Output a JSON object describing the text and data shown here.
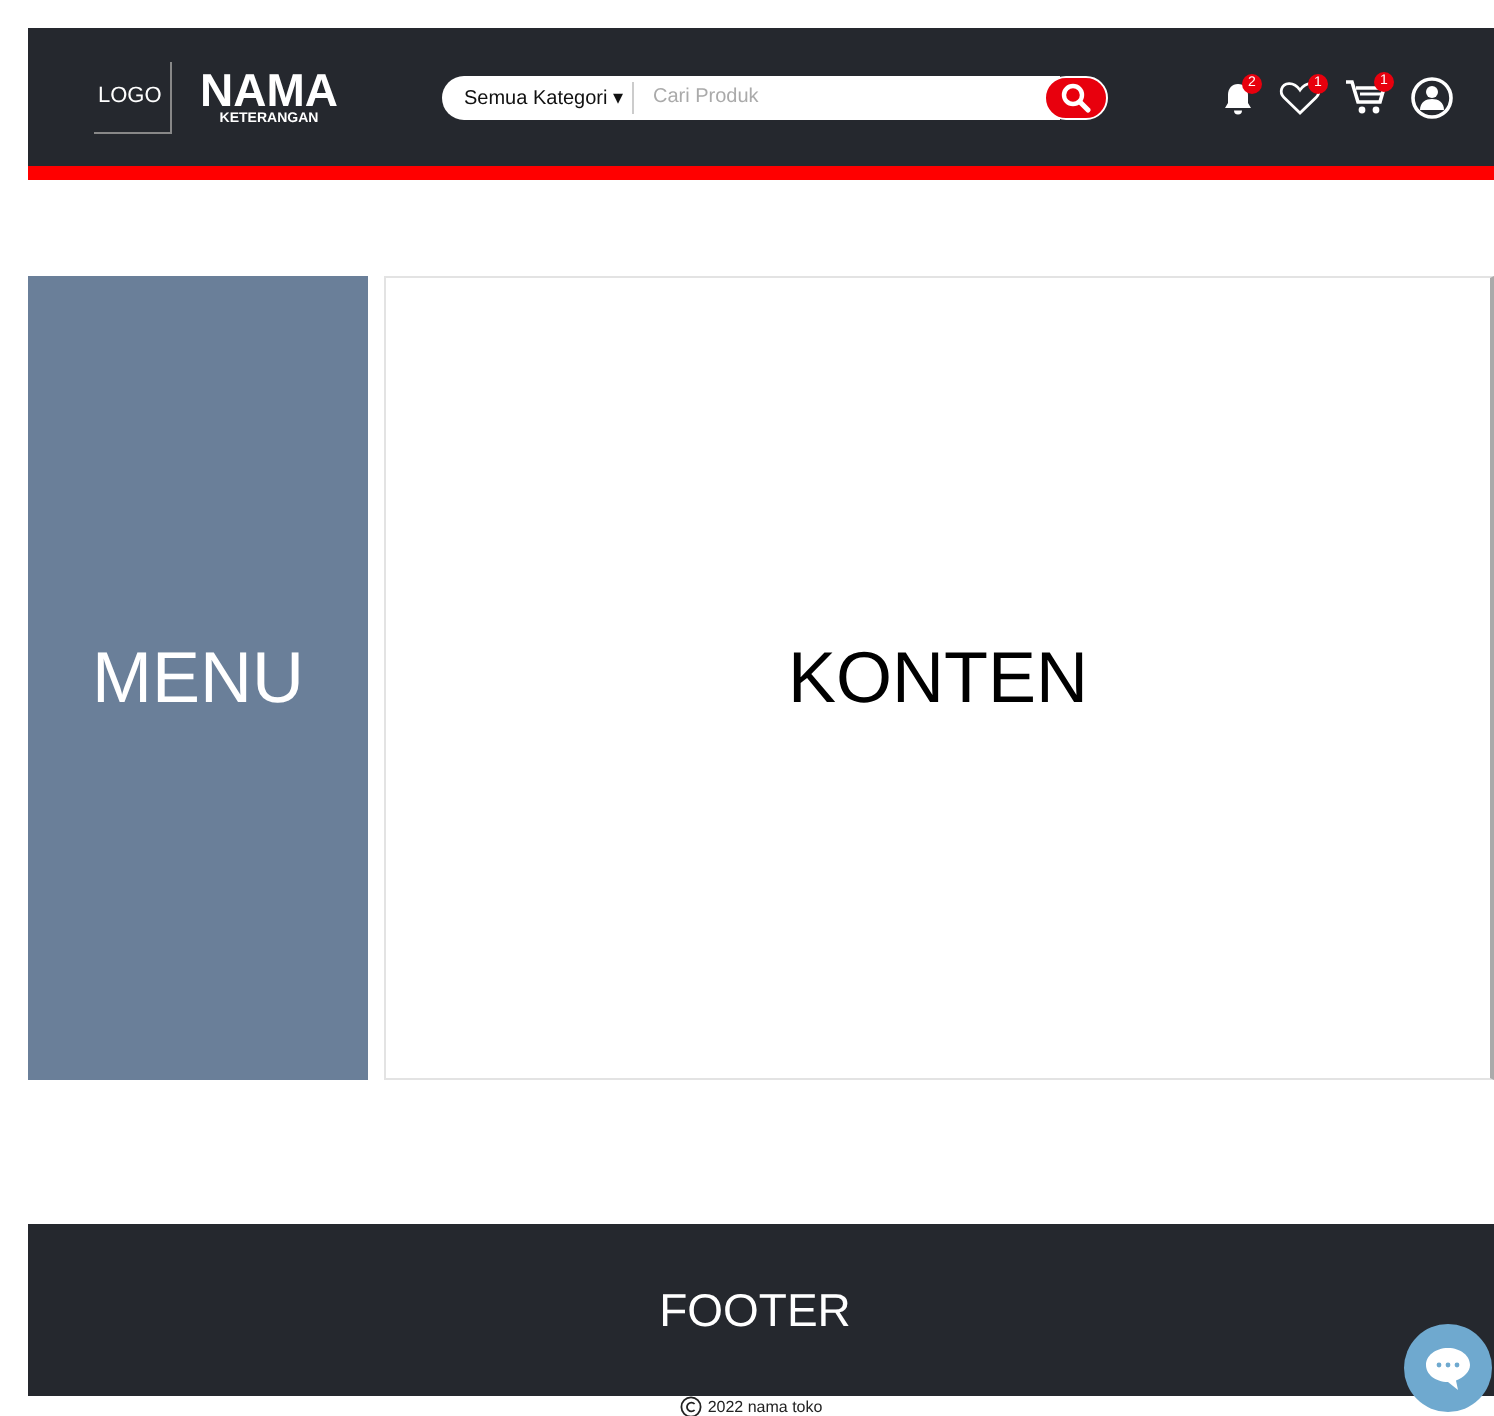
{
  "header": {
    "logo": "LOGO",
    "brand": "NAMA",
    "tagline": "KETERANGAN",
    "search": {
      "category": "Semua Kategori",
      "caret": "▾",
      "placeholder": "Cari Produk"
    },
    "actions": [
      {
        "kind": "bell",
        "badge": "2"
      },
      {
        "kind": "heart",
        "badge": "1"
      },
      {
        "kind": "cart",
        "badge": "1"
      },
      {
        "kind": "user"
      }
    ]
  },
  "menu": {
    "label": "MENU"
  },
  "content": {
    "label": "KONTEN"
  },
  "footer": {
    "label": "FOOTER",
    "copyright": "2022 nama toko"
  }
}
